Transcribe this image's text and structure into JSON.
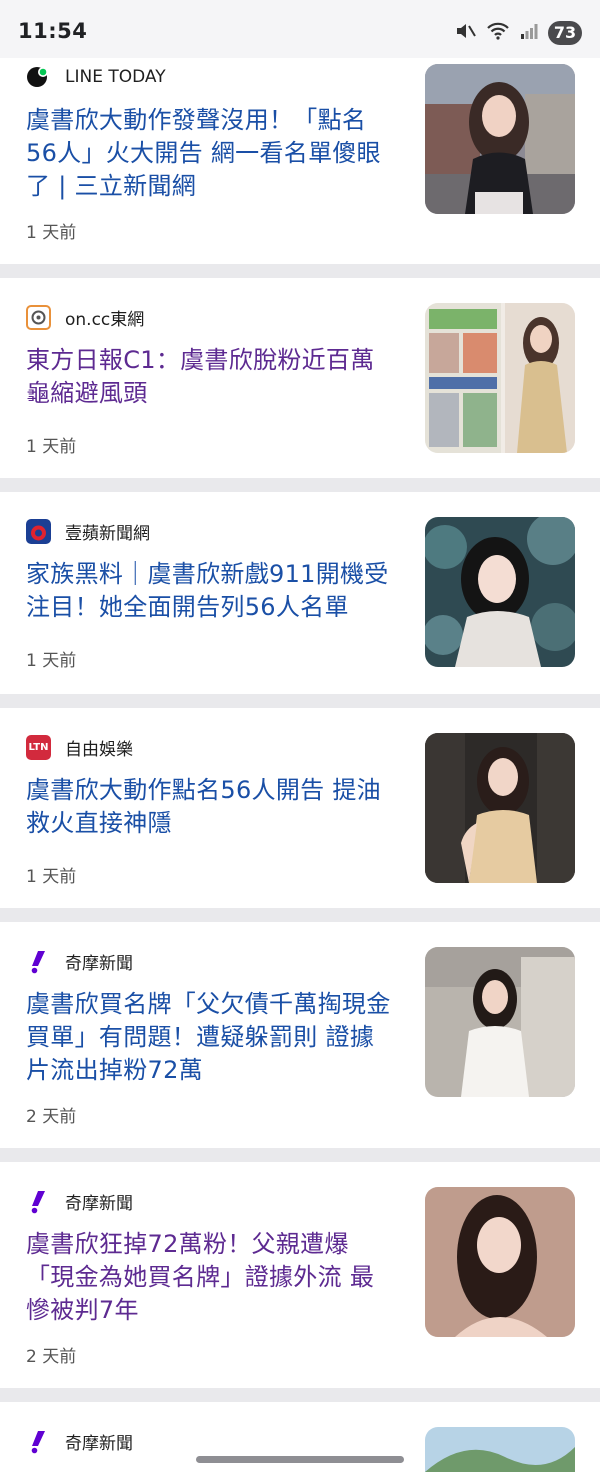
{
  "status_bar": {
    "time": "11:54",
    "battery": "73"
  },
  "articles": [
    {
      "source": "LINE TODAY",
      "icon": "line-today-icon",
      "title_lines": [
        "虞書欣大動作發聲沒用！「點名",
        "56人」火大開告 網一看名單傻眼",
        "了 | 三立新聞網"
      ],
      "time": "1 天前",
      "visited": false
    },
    {
      "source": "on.cc東網",
      "icon": "oncc-icon",
      "title_lines": [
        "東方日報C1：虞書欣脫粉近百萬",
        "龜縮避風頭"
      ],
      "time": "1 天前",
      "visited": true
    },
    {
      "source": "壹蘋新聞網",
      "icon": "nextapple-icon",
      "title_lines": [
        "家族黑料｜虞書欣新戲911開機受",
        "注目！她全面開告列56人名單"
      ],
      "time": "1 天前",
      "visited": false
    },
    {
      "source": "自由娛樂",
      "icon": "ltn-icon",
      "title_lines": [
        "虞書欣大動作點名56人開告 提油",
        "救火直接神隱"
      ],
      "time": "1 天前",
      "visited": false
    },
    {
      "source": "奇摩新聞",
      "icon": "yahoo-icon",
      "title_lines": [
        "虞書欣買名牌「父欠債千萬掏現金",
        "買單」有問題！遭疑躲罰則 證據",
        "片流出掉粉72萬"
      ],
      "time": "2 天前",
      "visited": false
    },
    {
      "source": "奇摩新聞",
      "icon": "yahoo-icon",
      "title_lines": [
        "虞書欣狂掉72萬粉！父親遭爆",
        "「現金為她買名牌」證據外流 最",
        "慘被判7年"
      ],
      "time": "2 天前",
      "visited": true
    },
    {
      "source": "奇摩新聞",
      "icon": "yahoo-icon",
      "title_lines": [],
      "time": "",
      "visited": false
    }
  ],
  "ltn_label": "LTN",
  "colors": {
    "link": "#1a4fa6",
    "visited": "#5d2a91",
    "divider": "#e9e9ec"
  }
}
